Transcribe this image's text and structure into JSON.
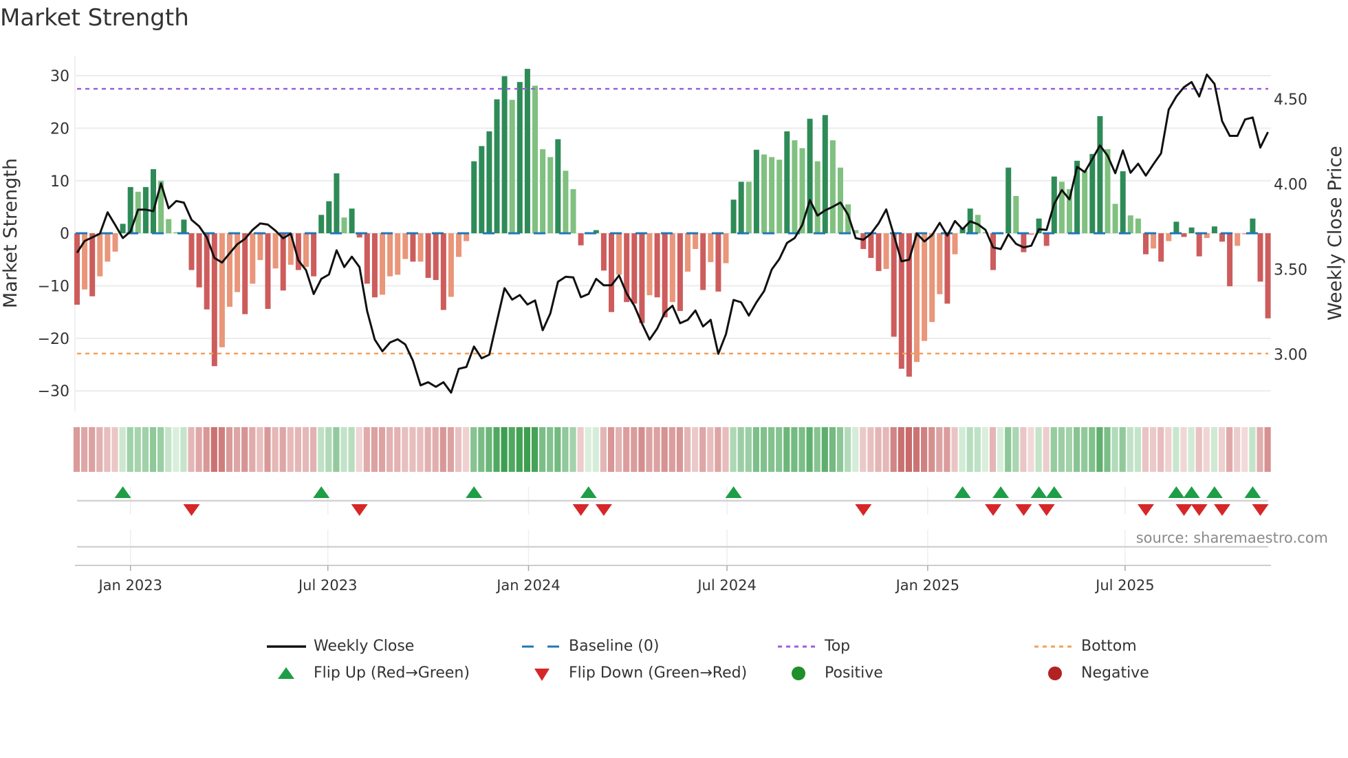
{
  "title": "Market Strength",
  "source_label": "source: sharemaestro.com",
  "colors": {
    "bar_pos_strong": "#2e8b57",
    "bar_pos_weak": "#80c080",
    "bar_neg_strong": "#cd5c5c",
    "bar_neg_weak": "#e9967a",
    "close_line": "#111111",
    "baseline": "#1f77b4",
    "top": "#9b5fd6",
    "bottom": "#f2a05a",
    "flip_up": "#1e9e46",
    "flip_down": "#d62728",
    "positive": "#1f8f2a",
    "negative": "#b22222"
  },
  "chart_data": {
    "type": "bar",
    "title": "Market Strength",
    "ylabel": "Market Strength",
    "ylabel_right": "Weekly Close Price",
    "ylim": [
      -33.9,
      33.8
    ],
    "ylim_right": [
      2.664,
      4.755
    ],
    "start_date": "2022-11-13",
    "interval_days": 7,
    "top_level": 27.5,
    "bottom_level": -22.9,
    "baseline": 0,
    "y_ticks": [
      {
        "v": 30,
        "label": "30"
      },
      {
        "v": 20,
        "label": "20"
      },
      {
        "v": 10,
        "label": "10"
      },
      {
        "v": 0,
        "label": "0"
      },
      {
        "v": -10,
        "label": "−10"
      },
      {
        "v": -20,
        "label": "−20"
      },
      {
        "v": -30,
        "label": "−30"
      }
    ],
    "y_ticks_right": [
      {
        "v": 4.5,
        "label": "4.50"
      },
      {
        "v": 4.0,
        "label": "4.00"
      },
      {
        "v": 3.5,
        "label": "3.50"
      },
      {
        "v": 3.0,
        "label": "3.00"
      }
    ],
    "x_ticks": [
      {
        "date": "2023-01-01",
        "label": "Jan 2023"
      },
      {
        "date": "2023-07-01",
        "label": "Jul 2023"
      },
      {
        "date": "2024-01-01",
        "label": "Jan 2024"
      },
      {
        "date": "2024-07-01",
        "label": "Jul 2024"
      },
      {
        "date": "2025-01-01",
        "label": "Jan 2025"
      },
      {
        "date": "2025-07-01",
        "label": "Jul 2025"
      }
    ],
    "strength": [
      -13.6,
      -10.7,
      -12.0,
      -8.2,
      -5.4,
      -3.5,
      1.8,
      8.8,
      7.9,
      8.8,
      12.2,
      10.0,
      2.7,
      0.2,
      2.6,
      -7.0,
      -10.3,
      -14.5,
      -25.3,
      -21.7,
      -14.0,
      -11.2,
      -15.4,
      -9.6,
      -5.1,
      -14.4,
      -6.7,
      -10.9,
      -6.0,
      -7.0,
      -6.4,
      -8.2,
      3.5,
      6.1,
      11.4,
      3.0,
      4.7,
      -0.8,
      -9.6,
      -12.2,
      -11.7,
      -8.2,
      -7.9,
      -4.9,
      -5.4,
      -5.4,
      -8.5,
      -8.9,
      -14.6,
      -12.1,
      -4.5,
      -1.5,
      13.7,
      16.6,
      19.4,
      25.5,
      29.9,
      25.4,
      28.8,
      31.3,
      28.1,
      16.0,
      14.5,
      17.9,
      11.9,
      8.4,
      -2.3,
      0.2,
      0.6,
      -7.1,
      -15.0,
      -7.9,
      -13.1,
      -13.4,
      -17.1,
      -11.8,
      -12.2,
      -16.0,
      -13.1,
      -14.8,
      -7.3,
      -3.0,
      -10.8,
      -5.5,
      -11.1,
      -5.7,
      6.4,
      9.8,
      9.8,
      15.9,
      15.0,
      14.5,
      14.0,
      19.4,
      17.7,
      16.2,
      21.8,
      13.7,
      22.5,
      17.7,
      12.5,
      5.5,
      0.6,
      -3.0,
      -4.7,
      -7.2,
      -6.8,
      -19.7,
      -25.8,
      -27.3,
      -24.5,
      -20.5,
      -16.9,
      -11.6,
      -13.4,
      -4.0,
      1.0,
      4.7,
      3.5,
      0.2,
      -7.0,
      0.2,
      12.5,
      7.1,
      -3.6,
      -0.3,
      2.8,
      -2.4,
      10.8,
      9.8,
      8.4,
      13.8,
      11.9,
      15.1,
      22.3,
      16.0,
      5.6,
      11.8,
      3.4,
      2.8,
      -4.0,
      -2.9,
      -5.4,
      -1.5,
      2.2,
      -0.7,
      1.1,
      -4.4,
      -0.9,
      1.3,
      -1.6,
      -10.1,
      -2.4,
      -0.2,
      2.8,
      -9.2,
      -16.2
    ],
    "weekly_close": [
      3.597,
      3.666,
      3.687,
      3.709,
      3.834,
      3.76,
      3.683,
      3.721,
      3.85,
      3.85,
      3.841,
      4.004,
      3.858,
      3.901,
      3.891,
      3.79,
      3.752,
      3.687,
      3.566,
      3.539,
      3.594,
      3.647,
      3.678,
      3.731,
      3.769,
      3.762,
      3.726,
      3.681,
      3.709,
      3.551,
      3.494,
      3.354,
      3.443,
      3.469,
      3.611,
      3.512,
      3.573,
      3.512,
      3.254,
      3.086,
      3.017,
      3.069,
      3.088,
      3.057,
      2.962,
      2.817,
      2.835,
      2.808,
      2.835,
      2.774,
      2.914,
      2.925,
      3.045,
      2.976,
      2.997,
      3.194,
      3.388,
      3.321,
      3.348,
      3.292,
      3.316,
      3.141,
      3.24,
      3.426,
      3.455,
      3.452,
      3.335,
      3.354,
      3.443,
      3.405,
      3.405,
      3.463,
      3.357,
      3.285,
      3.18,
      3.086,
      3.151,
      3.245,
      3.285,
      3.182,
      3.202,
      3.257,
      3.163,
      3.202,
      3.002,
      3.117,
      3.319,
      3.305,
      3.227,
      3.305,
      3.371,
      3.498,
      3.56,
      3.654,
      3.683,
      3.76,
      3.906,
      3.815,
      3.846,
      3.867,
      3.892,
      3.82,
      3.683,
      3.673,
      3.709,
      3.769,
      3.851,
      3.7,
      3.546,
      3.556,
      3.709,
      3.663,
      3.7,
      3.772,
      3.697,
      3.783,
      3.735,
      3.781,
      3.764,
      3.731,
      3.628,
      3.618,
      3.705,
      3.649,
      3.628,
      3.638,
      3.735,
      3.731,
      3.884,
      3.965,
      3.91,
      4.102,
      4.071,
      4.148,
      4.227,
      4.167,
      4.064,
      4.198,
      4.067,
      4.12,
      4.05,
      4.117,
      4.181,
      4.438,
      4.515,
      4.57,
      4.6,
      4.515,
      4.644,
      4.589,
      4.37,
      4.284,
      4.284,
      4.38,
      4.392,
      4.215,
      4.306
    ],
    "legend": [
      {
        "label": "Weekly Close",
        "kind": "line"
      },
      {
        "label": "Baseline (0)",
        "kind": "dash"
      },
      {
        "label": "Top",
        "kind": "dot-top"
      },
      {
        "label": "Bottom",
        "kind": "dot-bottom"
      },
      {
        "label": "Flip Up (Red→Green)",
        "kind": "tri-up"
      },
      {
        "label": "Flip Down (Green→Red)",
        "kind": "tri-down"
      },
      {
        "label": "Positive",
        "kind": "dot-pos"
      },
      {
        "label": "Negative",
        "kind": "dot-neg"
      }
    ],
    "legend_position": "bottom-center"
  }
}
